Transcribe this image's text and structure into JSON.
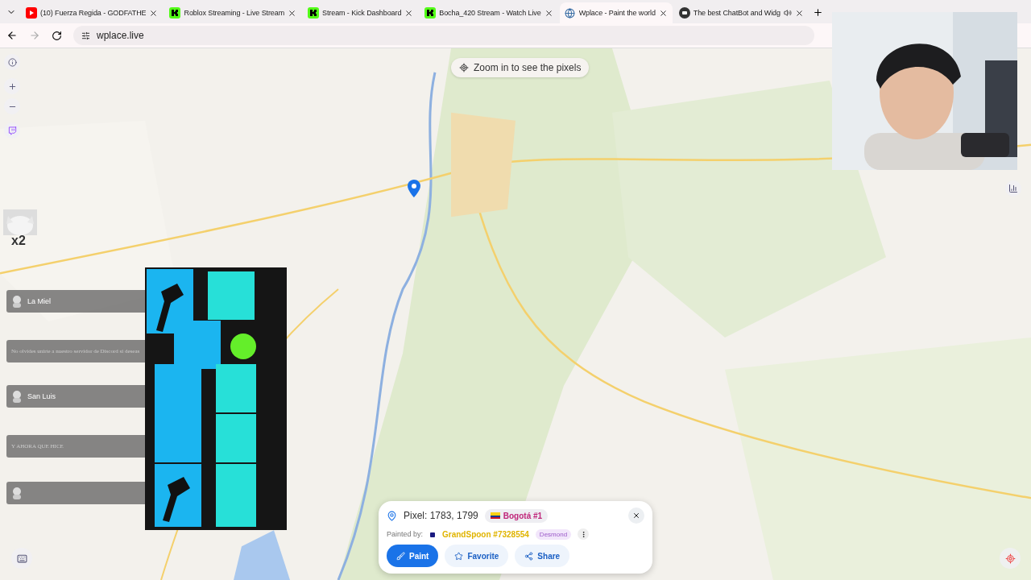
{
  "tabs": [
    {
      "title": "(10) Fuerza Regida - GODFATHE",
      "kind": "youtube",
      "selected": false,
      "audio": false
    },
    {
      "title": "Roblox Streaming - Live Stream",
      "kind": "kick",
      "selected": false,
      "audio": false
    },
    {
      "title": "Stream - Kick Dashboard",
      "kind": "kick",
      "selected": false,
      "audio": false
    },
    {
      "title": "Bocha_420 Stream - Watch Live",
      "kind": "kick",
      "selected": false,
      "audio": false
    },
    {
      "title": "Wplace - Paint the world",
      "kind": "globe",
      "selected": true,
      "audio": false
    },
    {
      "title": "The best ChatBot and Widg",
      "kind": "bot",
      "selected": false,
      "audio": true
    }
  ],
  "address": "wplace.live",
  "map": {
    "hint": "Zoom in to see the pixels"
  },
  "emote": {
    "count": "x2"
  },
  "alerts": [
    {
      "kind": "avatar",
      "text": "La Miel"
    },
    {
      "kind": "plain",
      "text": "No olvides unirte a nuestro servidor de Discord si deseas"
    },
    {
      "kind": "avatar",
      "text": "San Luis"
    },
    {
      "kind": "plain",
      "text": "Y AHORA QUE HICE"
    },
    {
      "kind": "avatar"
    }
  ],
  "pixel_card": {
    "pixel": "Pixel: 1783, 1799",
    "region": "Bogotá #1",
    "painted_by": "Painted by:",
    "user": "GrandSpoon #7328554",
    "tag": "Desmond",
    "buttons": [
      {
        "label": "Paint",
        "kind": "primary"
      },
      {
        "label": "Favorite",
        "kind": "favorite"
      },
      {
        "label": "Share",
        "kind": "share"
      }
    ]
  }
}
